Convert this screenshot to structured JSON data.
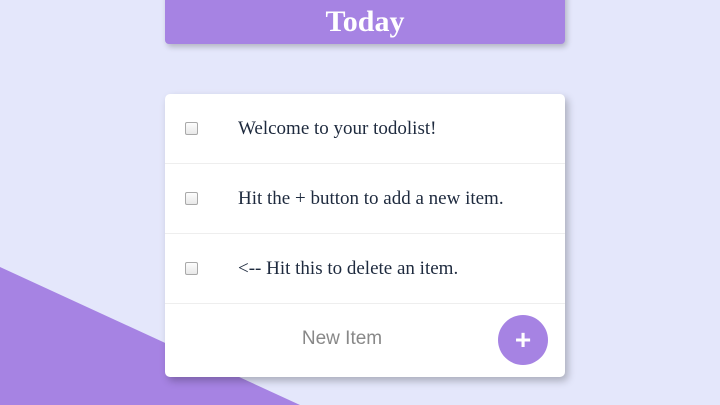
{
  "heading": {
    "title": "Today"
  },
  "list": {
    "items": [
      {
        "text": "Welcome to your todolist!",
        "checked": false
      },
      {
        "text": "Hit the + button to add a new item.",
        "checked": false
      },
      {
        "text": "<-- Hit this to delete an item.",
        "checked": false
      }
    ]
  },
  "new_item": {
    "placeholder": "New Item",
    "value": "",
    "add_label": "+"
  },
  "colors": {
    "background": "#E4E7FB",
    "accent": "#A683E3",
    "card": "#FFFFFF",
    "text": "#1E2A3E"
  }
}
